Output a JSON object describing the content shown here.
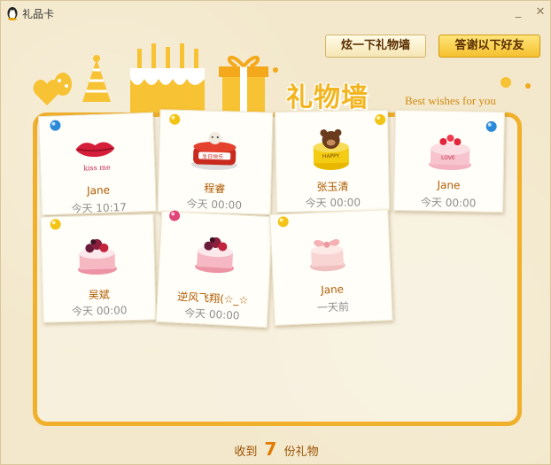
{
  "window": {
    "title": "礼品卡",
    "minimize": "_",
    "close": "✕"
  },
  "header": {
    "show_wall_button": "炫一下礼物墙",
    "thank_friends_button": "答谢以下好友",
    "wall_title": "礼物墙",
    "wall_subtitle": "Best wishes for you"
  },
  "gifts": [
    {
      "name": "Jane",
      "time": "今天 10:17",
      "icon": "lips-kiss-card-icon",
      "caption": "kiss me"
    },
    {
      "name": "程睿",
      "time": "今天 00:00",
      "icon": "birthday-cake-icon",
      "caption": "生日快乐"
    },
    {
      "name": "张玉清",
      "time": "今天 00:00",
      "icon": "bear-cake-icon",
      "caption": "HAPPY"
    },
    {
      "name": "Jane",
      "time": "今天 00:00",
      "icon": "heart-cake-icon",
      "caption": "LOVE"
    },
    {
      "name": "吴斌",
      "time": "今天 00:00",
      "icon": "berry-cake-icon"
    },
    {
      "name": "逆风飞翔(☆_☆",
      "time": "今天 00:00",
      "icon": "berry-cake-icon"
    },
    {
      "name": "Jane",
      "time": "一天前",
      "icon": "bow-cake-icon"
    }
  ],
  "footer": {
    "prefix": "收到",
    "count": "7",
    "suffix": "份礼物"
  },
  "colors": {
    "frame": "#f0b02c",
    "name": "#b05a00",
    "accent": "#e07b00"
  }
}
